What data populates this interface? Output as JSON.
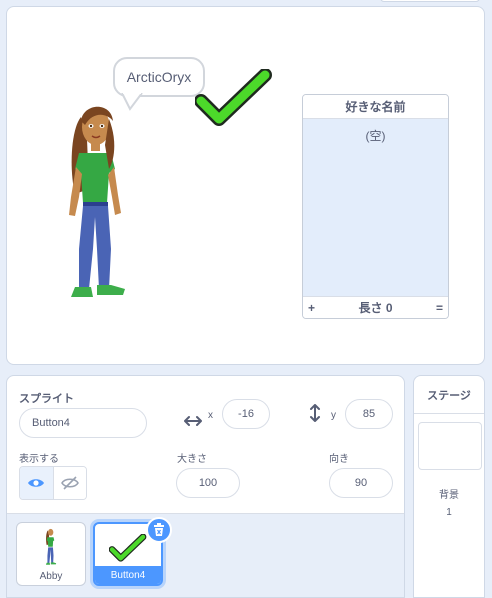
{
  "stage": {
    "speech_bubble": "ArcticOryx",
    "list_monitor": {
      "title": "好きな名前",
      "empty_text": "(空)",
      "add_symbol": "+",
      "length_label": "長さ 0",
      "resize_symbol": "="
    }
  },
  "sprite_info": {
    "sprite_label": "スプライト",
    "sprite_name": "Button4",
    "x_label": "x",
    "x_value": "-16",
    "y_label": "y",
    "y_value": "85",
    "show_label": "表示する",
    "size_label": "大きさ",
    "size_value": "100",
    "direction_label": "向き",
    "direction_value": "90",
    "icons": [
      "x-arrows-icon",
      "y-arrows-icon",
      "eye-icon",
      "eye-slash-icon",
      "trash-icon"
    ]
  },
  "sprites": [
    {
      "name": "Abby",
      "selected": false
    },
    {
      "name": "Button4",
      "selected": true
    }
  ],
  "stage_panel": {
    "title": "ステージ",
    "backdrops_label": "背景",
    "backdrops_count": "1"
  },
  "colors": {
    "accent": "#4c97ff",
    "check_green": "#4cd92a",
    "panel_bg": "#e7eef9",
    "list_body": "#e3edfb"
  }
}
